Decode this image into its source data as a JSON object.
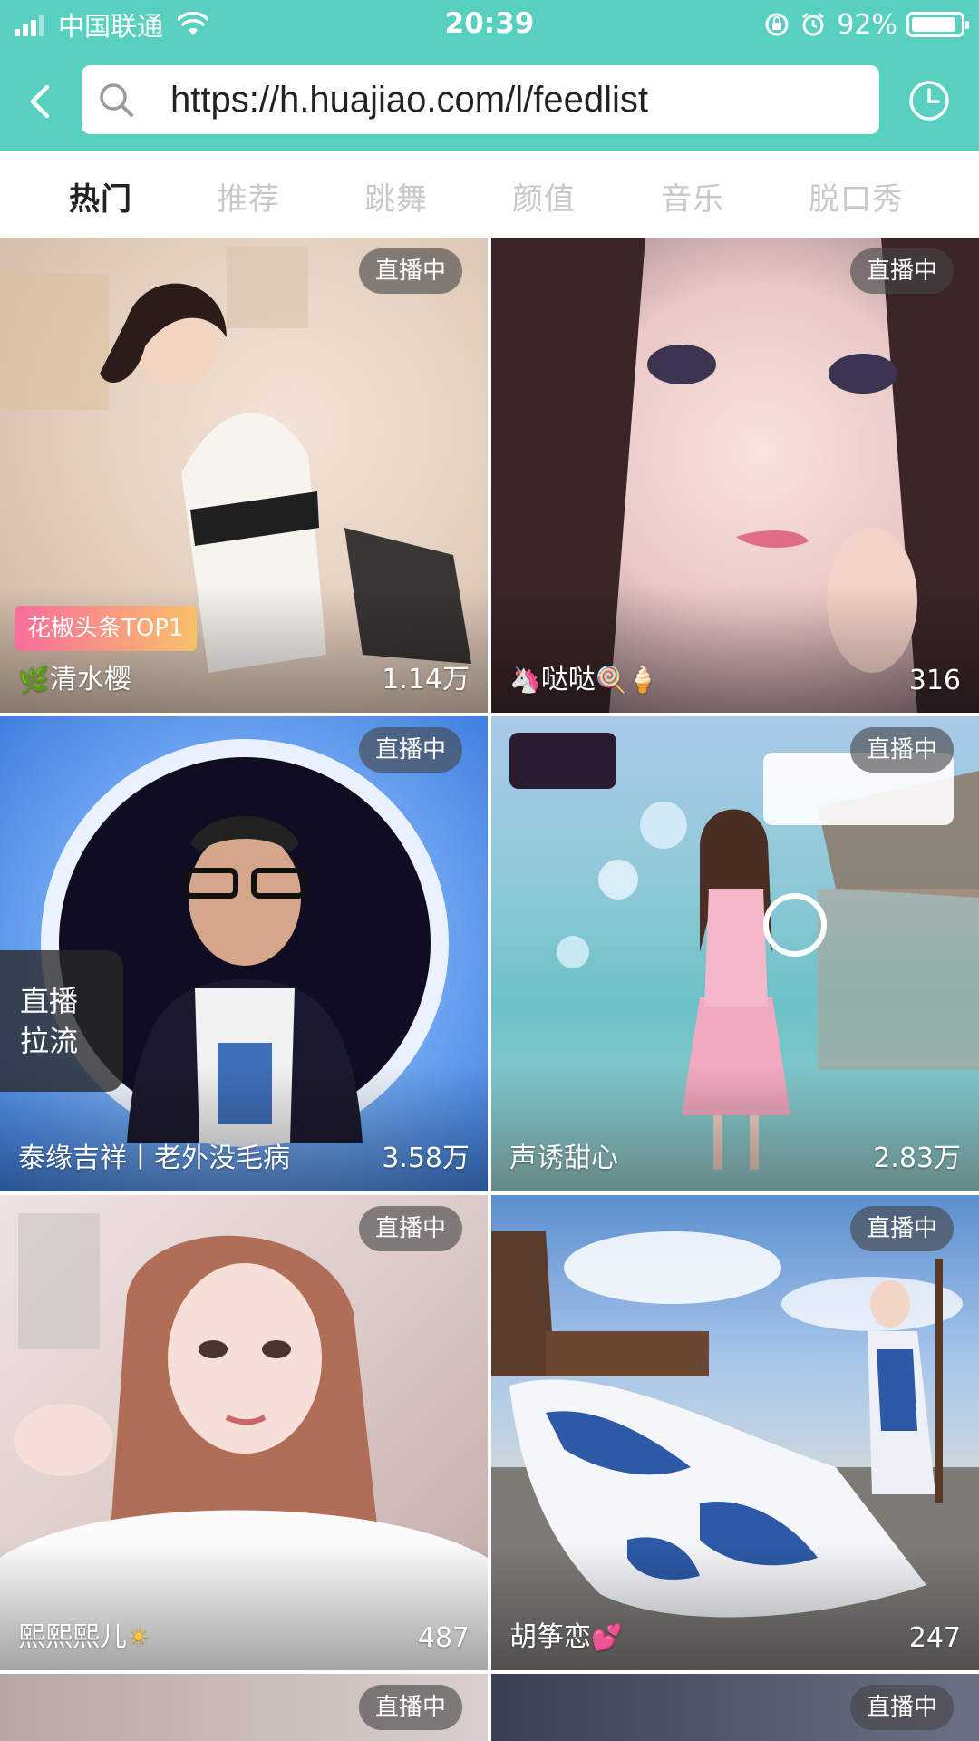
{
  "status_bar": {
    "carrier": "中国联通",
    "time": "20:39",
    "battery_pct": "92%",
    "battery_level": 0.92
  },
  "browser": {
    "url": "https://h.huajiao.com/l/feedlist"
  },
  "tabs": [
    {
      "label": "热门",
      "active": true
    },
    {
      "label": "推荐",
      "active": false
    },
    {
      "label": "跳舞",
      "active": false
    },
    {
      "label": "颜值",
      "active": false
    },
    {
      "label": "音乐",
      "active": false
    },
    {
      "label": "脱口秀",
      "active": false
    }
  ],
  "live_badge": "直播中",
  "cards": [
    {
      "title": "清水樱",
      "title_prefix": "🌿",
      "title_suffix": "",
      "count": "1.14万",
      "rank_tag": "花椒头条TOP1"
    },
    {
      "title": "哒哒",
      "title_prefix": "🦄",
      "title_suffix": "🍭🍦",
      "count": "316"
    },
    {
      "title": "泰缘吉祥丨老外没毛病",
      "title_prefix": "",
      "title_suffix": "",
      "count": "3.58万"
    },
    {
      "title": "声诱甜心",
      "title_prefix": "",
      "title_suffix": "",
      "count": "2.83万"
    },
    {
      "title": "熙熙熙儿",
      "title_prefix": "",
      "title_suffix": "☀",
      "count": "487"
    },
    {
      "title": "胡筝恋",
      "title_prefix": "",
      "title_suffix": "💕",
      "count": "247"
    }
  ],
  "float_tag": {
    "line1": "直播",
    "line2": "拉流"
  },
  "colors": {
    "accent": "#58d0c0"
  }
}
